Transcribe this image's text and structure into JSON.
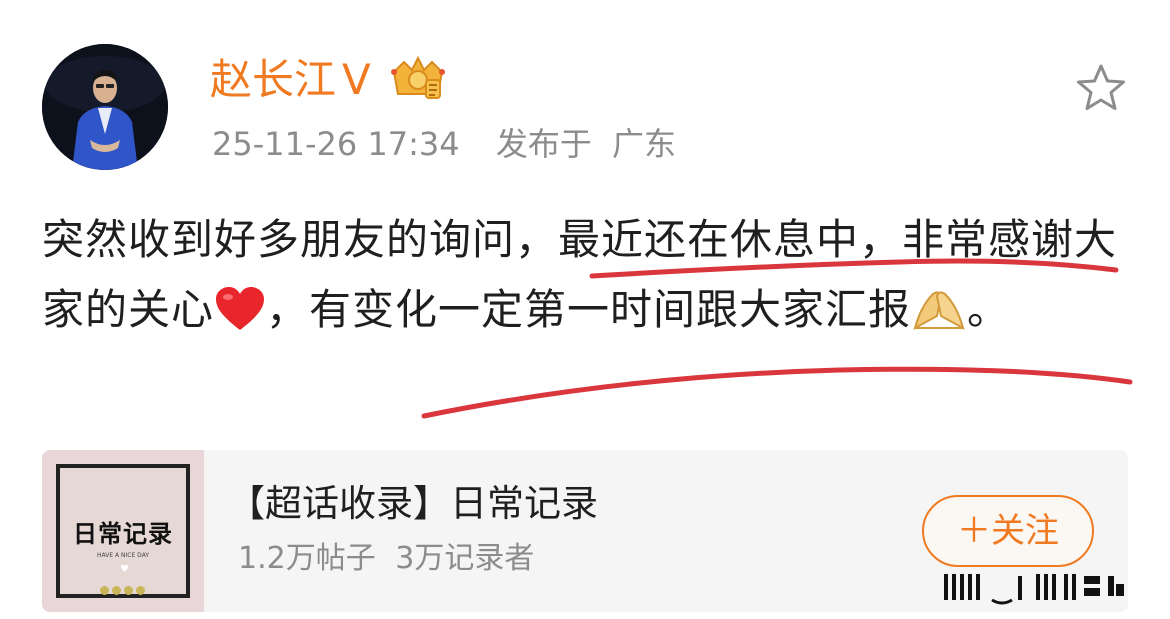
{
  "user": {
    "name": "赵长江",
    "vip_mark": "V",
    "avatar": "avatar-photo",
    "badge": "crown-badge-icon"
  },
  "post": {
    "timestamp": "25-11-26 17:34",
    "location_prefix": "发布于",
    "location": "广东",
    "favorite_icon": "star-outline-icon",
    "text_part1": "突然收到好多朋友的询问，最近还在休息中，非常感谢大家的关心",
    "emoji1": "red-heart-icon",
    "text_part2": "，有变化一定第一时间跟大家汇报",
    "emoji2": "folded-hands-icon",
    "text_part3": "。"
  },
  "topic_card": {
    "thumbnail_title": "日常记录",
    "thumbnail_subtitle": "HAVE A NICE DAY",
    "title": "【超话收录】日常记录",
    "posts_count": "1.2万帖子",
    "recorders_count": "3万记录者",
    "follow_label": "＋关注"
  },
  "colors": {
    "accent": "#f07a21",
    "annotation_red": "#d9363e",
    "text_primary": "#1f1f1f",
    "text_secondary": "#8c8c8c"
  }
}
